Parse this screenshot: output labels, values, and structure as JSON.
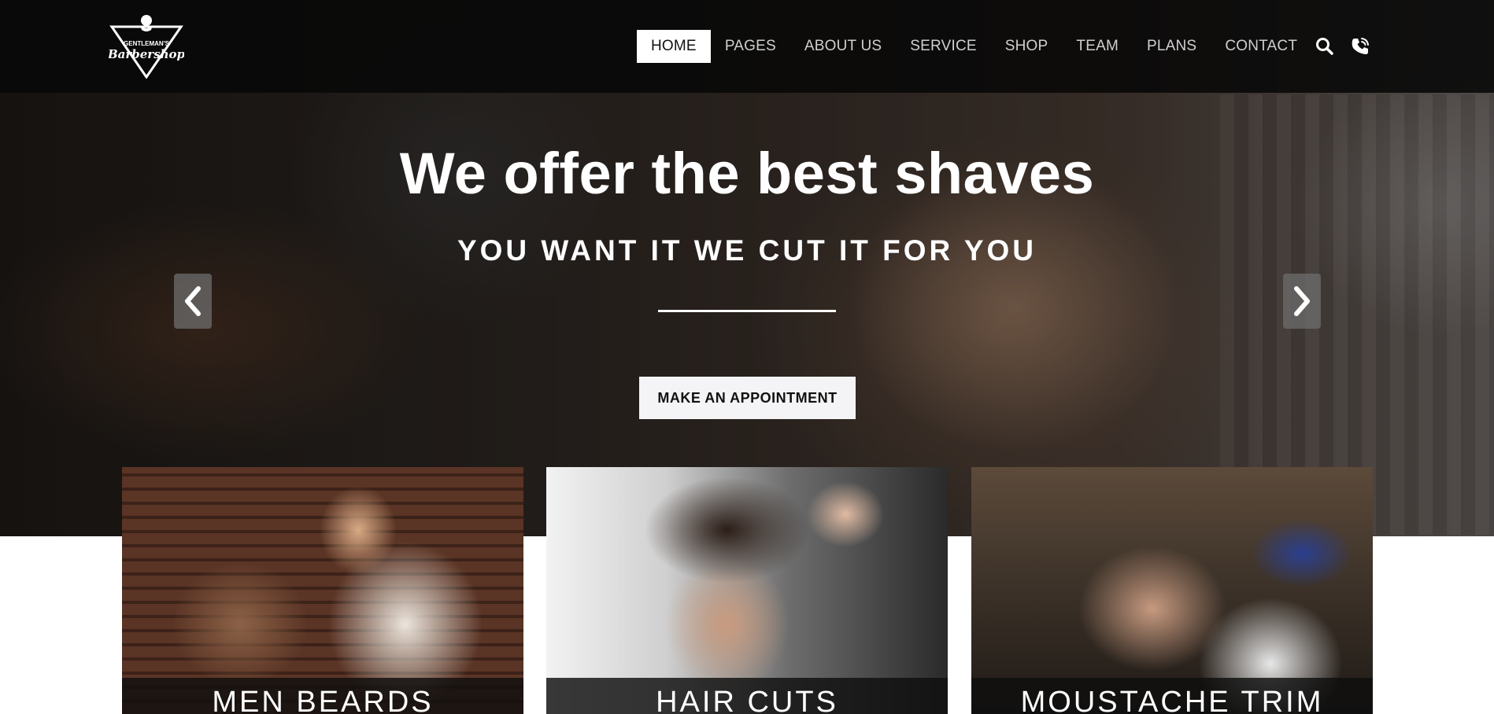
{
  "brand": {
    "line1": "GENTLEMAN'S",
    "line2": "Barbershop"
  },
  "nav": {
    "items": [
      {
        "label": "HOME",
        "active": true
      },
      {
        "label": "PAGES",
        "active": false
      },
      {
        "label": "ABOUT US",
        "active": false
      },
      {
        "label": "SERVICE",
        "active": false
      },
      {
        "label": "SHOP",
        "active": false
      },
      {
        "label": "TEAM",
        "active": false
      },
      {
        "label": "PLANS",
        "active": false
      },
      {
        "label": "CONTACT",
        "active": false
      }
    ],
    "search_icon": "search-icon",
    "phone_icon": "phone-icon"
  },
  "hero": {
    "title": "We offer the best shaves",
    "subtitle": "YOU WANT IT WE CUT IT FOR YOU",
    "cta_label": "MAKE AN APPOINTMENT",
    "prev_icon": "chevron-left-icon",
    "next_icon": "chevron-right-icon"
  },
  "cards": [
    {
      "title": "MEN BEARDS"
    },
    {
      "title": "HAIR CUTS"
    },
    {
      "title": "MOUSTACHE TRIM"
    }
  ],
  "colors": {
    "header_bg": "#080808",
    "active_nav_bg": "#ffffff",
    "nav_text": "#cfcfcf",
    "cta_bg": "#f4f4f6"
  }
}
